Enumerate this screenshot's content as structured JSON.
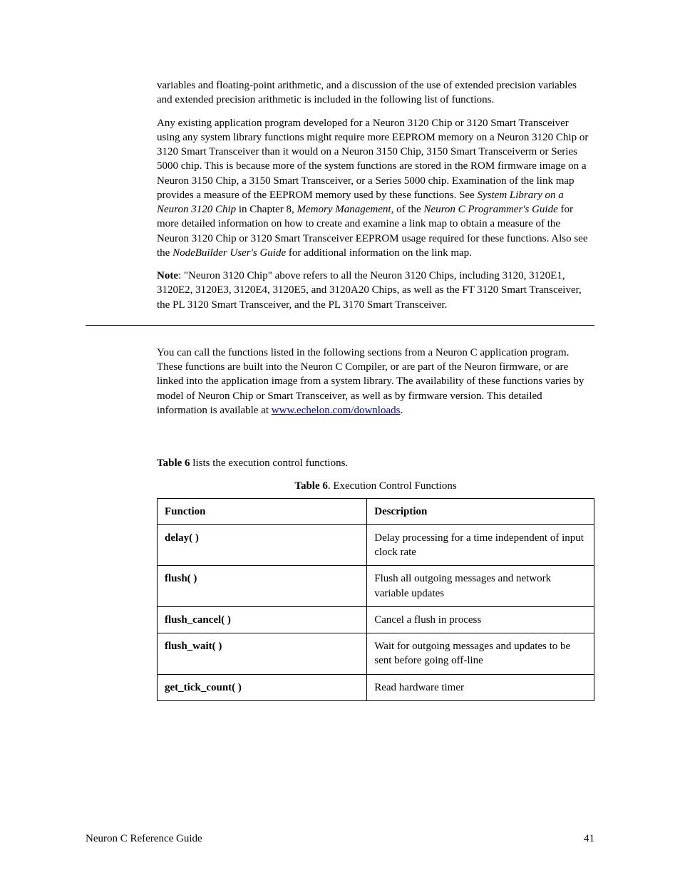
{
  "para1": "variables and floating-point arithmetic, and a discussion of the use of extended precision variables and extended precision arithmetic is included in the following list of functions.",
  "para2_a": "Any existing application program developed for a Neuron 3120 Chip or 3120 Smart Transceiver using any system library functions might require more EEPROM memory on a Neuron 3120 Chip or 3120 Smart Transceiver than it would on a Neuron 3150 Chip, 3150 Smart Transceiverm or Series 5000 chip. This is because more of the system functions are stored in the ROM firmware image on a Neuron 3150 Chip, a 3150 Smart Transceiver, or a Series 5000 chip. Examination of the link map provides a measure of the EEPROM memory used by these functions.  See ",
  "para2_i1": "System Library on a Neuron 3120 Chip",
  "para2_b": " in Chapter 8, ",
  "para2_i2": "Memory Management,",
  "para2_c": " of the ",
  "para2_i3": "Neuron C Programmer's Guide",
  "para2_d": " for more detailed information on how to create and examine a link map to obtain a measure of the Neuron 3120 Chip or 3120 Smart Transceiver EEPROM usage required for these functions.  Also see the ",
  "para2_i4": "NodeBuilder User's Guide",
  "para2_e": " for additional information on the link map.",
  "note_label": "Note",
  "note_body": ":  \"Neuron 3120 Chip\" above refers to all the Neuron 3120 Chips, including 3120, 3120E1, 3120E2, 3120E3, 3120E4, 3120E5, and 3120A20 Chips, as well as the FT 3120 Smart Transceiver, the PL 3120 Smart Transceiver, and the PL 3170 Smart Transceiver.",
  "para3_a": "You can call the functions listed in the following sections from a Neuron C application program.  These functions are built into the Neuron C Compiler, or are part of the Neuron firmware, or are linked into the application image from a system library.  The availability of these functions varies by model of Neuron Chip or Smart Transceiver, as well as by firmware version.  This detailed information is available at ",
  "para3_link": "www.echelon.com/downloads",
  "para3_b": ".",
  "table_intro_a": "Table 6",
  "table_intro_b": " lists the execution control functions.",
  "table_caption_a": "Table 6",
  "table_caption_b": ". Execution Control Functions",
  "th_function": "Function",
  "th_description": "Description",
  "rows": [
    {
      "fn": "delay( )",
      "desc": "Delay processing for a time independent of input clock rate"
    },
    {
      "fn": "flush( )",
      "desc": "Flush all outgoing messages and network variable updates"
    },
    {
      "fn": "flush_cancel( )",
      "desc": "Cancel a flush in process"
    },
    {
      "fn": "flush_wait( )",
      "desc": "Wait for outgoing messages and updates to be sent before going off-line"
    },
    {
      "fn": "get_tick_count( )",
      "desc": "Read hardware timer"
    }
  ],
  "footer_left": "Neuron C Reference Guide",
  "footer_right": "41"
}
